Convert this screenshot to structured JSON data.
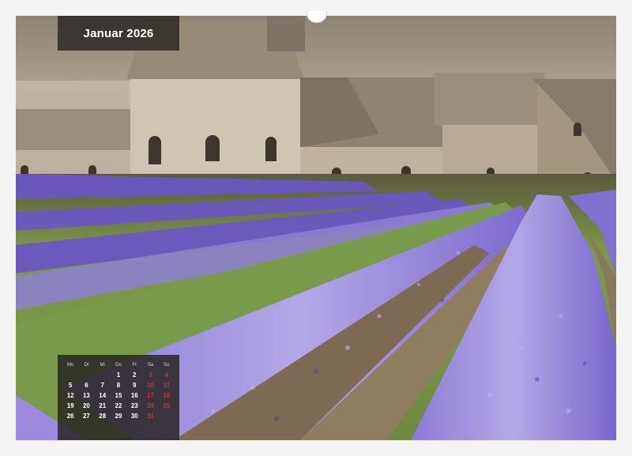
{
  "calendar": {
    "month_title": "Januar 2026",
    "weekday_headers": [
      "Mo",
      "Di",
      "Mi",
      "Do",
      "Fr",
      "Sa",
      "So"
    ],
    "weeks": [
      [
        "",
        "",
        "",
        "1",
        "2",
        "3",
        "4"
      ],
      [
        "5",
        "6",
        "7",
        "8",
        "9",
        "10",
        "11"
      ],
      [
        "12",
        "13",
        "14",
        "15",
        "16",
        "17",
        "18"
      ],
      [
        "19",
        "20",
        "21",
        "22",
        "23",
        "24",
        "25"
      ],
      [
        "26",
        "27",
        "28",
        "29",
        "30",
        "31",
        ""
      ]
    ]
  },
  "colors": {
    "weekend": "#c0392b",
    "overlay": "#282422",
    "lavender": "#7b62c9",
    "stone": "#bdb2a0"
  }
}
